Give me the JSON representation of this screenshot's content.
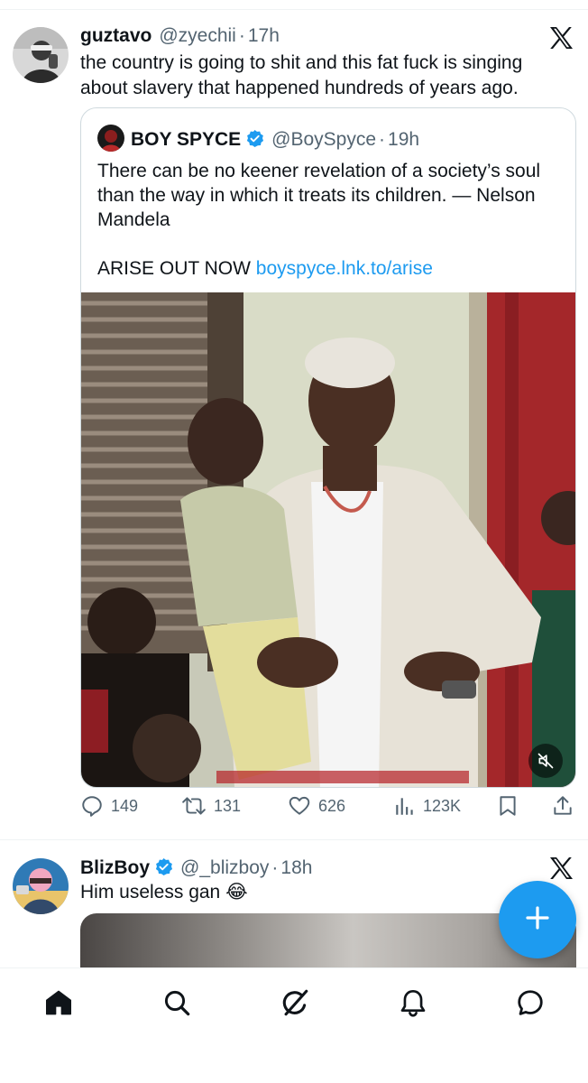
{
  "post1": {
    "name": "guztavo",
    "handle": "@zyechii",
    "separator": "·",
    "time": "17h",
    "text": "the country is going to shit and this fat fuck is singing about slavery that happened hundreds of years ago.",
    "quote": {
      "name": "BOY SPYCE",
      "handle": "@BoySpyce",
      "separator": "·",
      "time": "19h",
      "text": "There can be no keener revelation of a society’s soul than the way in which it treats its children. — Nelson Mandela",
      "cta_prefix": "ARISE OUT NOW ",
      "cta_link": "boyspyce.lnk.to/arise"
    },
    "actions": {
      "replies": "149",
      "reposts": "131",
      "likes": "626",
      "views": "123K"
    }
  },
  "post2": {
    "name": "BlizBoy",
    "handle": "@_blizboy",
    "separator": "·",
    "time": "18h",
    "text": "Him useless gan 😂"
  },
  "colors": {
    "accent": "#1d9bf0",
    "text": "#0f1419",
    "muted": "#536471",
    "border": "#cfd9de"
  },
  "icons": [
    "x-logo-icon",
    "verified-badge-icon",
    "reply-icon",
    "repost-icon",
    "like-icon",
    "views-icon",
    "bookmark-icon",
    "share-icon",
    "mute-icon",
    "compose-plus-icon",
    "home-icon",
    "search-icon",
    "grok-icon",
    "notifications-icon",
    "messages-icon"
  ]
}
